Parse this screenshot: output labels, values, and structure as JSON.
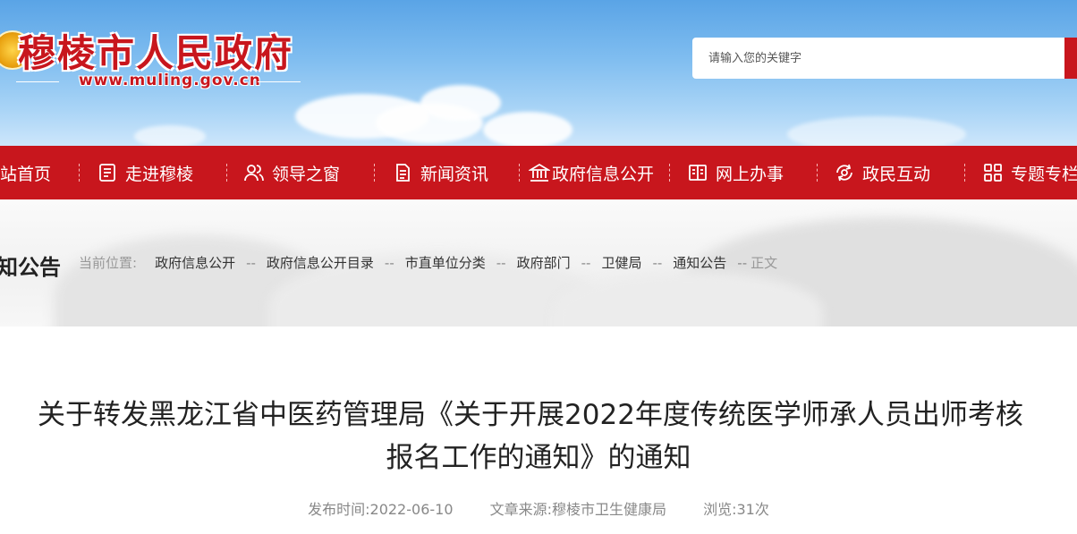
{
  "header": {
    "site_title": "穆棱市人民政府",
    "site_url": "www.muling.gov.cn",
    "search_placeholder": "请输入您的关键字"
  },
  "nav": {
    "items": [
      {
        "label": "站首页",
        "icon": "home-icon"
      },
      {
        "label": "走进穆棱",
        "icon": "document-icon"
      },
      {
        "label": "领导之窗",
        "icon": "people-icon"
      },
      {
        "label": "新闻资讯",
        "icon": "news-icon"
      },
      {
        "label": "政府信息公开",
        "icon": "government-building-icon"
      },
      {
        "label": "网上办事",
        "icon": "book-icon"
      },
      {
        "label": "政民互动",
        "icon": "interaction-icon"
      },
      {
        "label": "专题专栏",
        "icon": "grid-icon"
      }
    ]
  },
  "breadcrumb": {
    "section_title": "知公告",
    "prefix": "当前位置:",
    "links": [
      "政府信息公开",
      "政府信息公开目录",
      "市直单位分类",
      "政府部门",
      "卫健局",
      "通知公告"
    ],
    "separator": "--",
    "current": "正文"
  },
  "article": {
    "title_line1": "关于转发黑龙江省中医药管理局《关于开展2022年度传统医学师承人员出师考核",
    "title_line2": "报名工作的通知》的通知",
    "publish_time": "发布时间:2022-06-10",
    "source": "文章来源:穆棱市卫生健康局",
    "views": "浏览:31次"
  },
  "colors": {
    "brand_red": "#c8161d",
    "sky_blue": "#7fbdf0"
  }
}
